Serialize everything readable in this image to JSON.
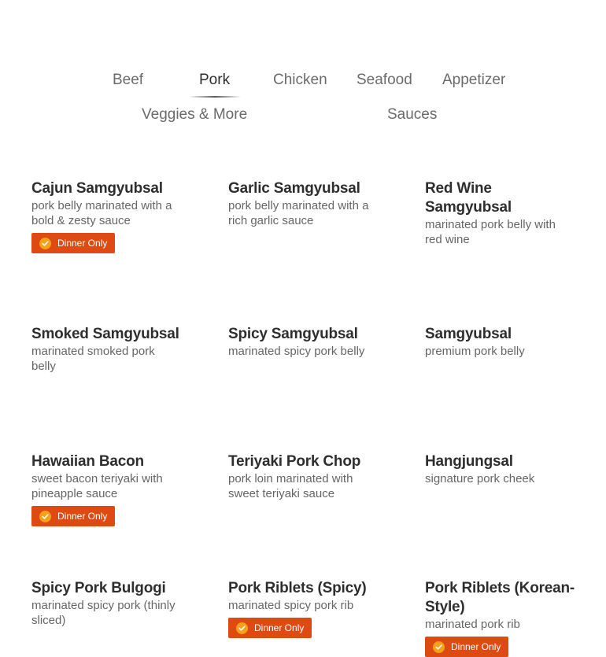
{
  "tabs": [
    {
      "label": "Beef",
      "active": false
    },
    {
      "label": "Pork",
      "active": true
    },
    {
      "label": "Chicken",
      "active": false
    },
    {
      "label": "Seafood",
      "active": false
    },
    {
      "label": "Appetizer",
      "active": false
    },
    {
      "label": "Veggies & More",
      "active": false
    },
    {
      "label": "Sauces",
      "active": false
    }
  ],
  "badge_label": "Dinner Only",
  "colors": {
    "badge_bg": "#dd4a12",
    "badge_icon": "#f7a11a"
  },
  "items": [
    {
      "title": "Cajun Samgyubsal",
      "desc": "pork belly marinated with a bold & zesty sauce",
      "badge": true
    },
    {
      "title": "Garlic Samgyubsal",
      "desc": "pork belly marinated with a rich garlic sauce",
      "badge": false
    },
    {
      "title": "Red Wine Samgyubsal",
      "desc": "marinated pork belly with red wine",
      "badge": false
    },
    {
      "title": "Smoked Samgyubsal",
      "desc": "marinated smoked pork belly",
      "badge": false
    },
    {
      "title": "Spicy Samgyubsal",
      "desc": "marinated spicy pork belly",
      "badge": false
    },
    {
      "title": "Samgyubsal",
      "desc": "premium pork belly",
      "badge": false
    },
    {
      "title": "Hawaiian Bacon",
      "desc": "sweet bacon teriyaki with pineapple sauce",
      "badge": true
    },
    {
      "title": "Teriyaki Pork Chop",
      "desc": "pork loin marinated with sweet teriyaki sauce",
      "badge": false
    },
    {
      "title": "Hangjungsal",
      "desc": "signature pork cheek",
      "badge": false
    },
    {
      "title": "Spicy Pork Bulgogi",
      "desc": "marinated spicy pork (thinly sliced)",
      "badge": false
    },
    {
      "title": "Pork Riblets (Spicy)",
      "desc": "marinated spicy pork rib",
      "badge": true
    },
    {
      "title": "Pork Riblets (Korean-Style)",
      "desc": "marinated pork rib",
      "badge": true
    }
  ]
}
